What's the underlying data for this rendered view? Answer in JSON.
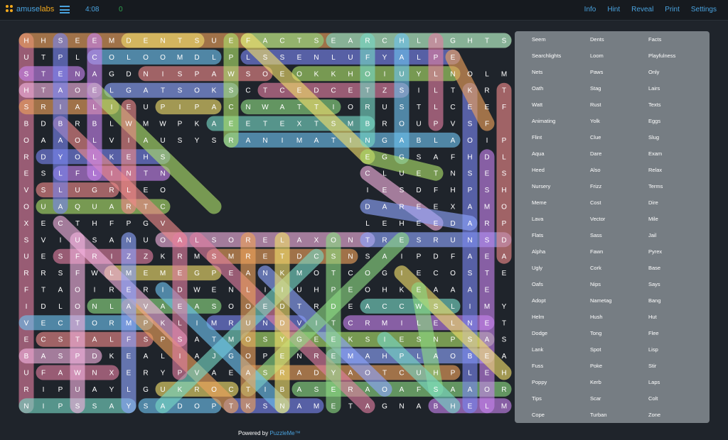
{
  "header": {
    "logo_left": "amuse",
    "logo_right": "labs",
    "timer": "4:08",
    "score": "0",
    "menu": [
      "Info",
      "Hint",
      "Reveal",
      "Print",
      "Settings"
    ]
  },
  "colors": {
    "background": "#1f242b",
    "accent": "#4aa3df",
    "score": "#2ea44f",
    "word_panel": "#767d83",
    "logo_orange": "#f2a81d"
  },
  "grid": {
    "rows": [
      "HHSEEMDENTSUEFACTSEARCHLIGHTS",
      "UTPLCOLOOMDLPLSSENLUFYALPE",
      "STENAGDNISPAWSOEOKKHOIUYLNOLM",
      "HTAOELGATSOKSCTCEDCETZSILTKRT",
      "SRIALIEUPIPACNWATTIORUSTLCEEF",
      "BDBRBLWMWPKAEETEXTSMBROUPVSF",
      "OAAOLVIAUSYSRANIMATINGABLAOIP",
      "RDYOLKEHS",
      "ESLFLINTN",
      "VSLUGRLEO",
      "OUAQUARTC",
      "XECTHFPGV",
      "SVIUSANUOALSORELAXONTRESRUNSD",
      "UESFRIZZKRMSMRETDCSNSAIPDFAEA",
      "RRSFWLMEMEGPEANKMOTCOGIECOSTE",
      "FTAOIRERIDWENLIIUHPEOHKEAAAE",
      "IDLONLAVAEASOOEDTRDEACCWSLIMY",
      "VECTORMPKLIMRUNDVITCRMILELNET",
      "ECSTALFSPSATMOSYGEEKSIESNPSASS",
      "BASPDKEALIAJGOPENREMAHPLAOBEA",
      "UFAWNXERYPVAEASRADYAOTCUHPLEH",
      "RIPUAYLGUKROCTIBASERAOAFSAAOR",
      "NIPSSAYSADOPTKSNAMETAGNABHELM"
    ],
    "right_block": [
      "EGGSAFHDL",
      "CLUETNSES",
      "IESDFHPSHO",
      "DAREEXAMO",
      "LEHEEDARP"
    ]
  },
  "word_list": [
    "Seem",
    "Dents",
    "Facts",
    "Searchlights",
    "Loom",
    "Playfulness",
    "Nets",
    "Paws",
    "Only",
    "Oath",
    "Stag",
    "Lairs",
    "Watt",
    "Rust",
    "Texts",
    "Animating",
    "Yolk",
    "Eggs",
    "Flint",
    "Clue",
    "Slug",
    "Aqua",
    "Dare",
    "Exam",
    "Heed",
    "Also",
    "Relax",
    "Nursery",
    "Frizz",
    "Terms",
    "Meme",
    "Cost",
    "Dire",
    "Lava",
    "Vector",
    "Mile",
    "Flats",
    "Sass",
    "Jail",
    "Alpha",
    "Fawn",
    "Pyrex",
    "Ugly",
    "Cork",
    "Base",
    "Oafs",
    "Nips",
    "Says",
    "Adopt",
    "Nametag",
    "Bang",
    "Helm",
    "Hush",
    "Hut",
    "Dodge",
    "Tong",
    "Flee",
    "Lank",
    "Spot",
    "Lisp",
    "Fuss",
    "Poke",
    "Stir",
    "Poppy",
    "Kerb",
    "Laps",
    "Tips",
    "Scar",
    "Colt",
    "Cope",
    "Turban",
    "Zone"
  ],
  "footer": {
    "prefix": "Powered by ",
    "brand": "PuzzleMe™"
  }
}
